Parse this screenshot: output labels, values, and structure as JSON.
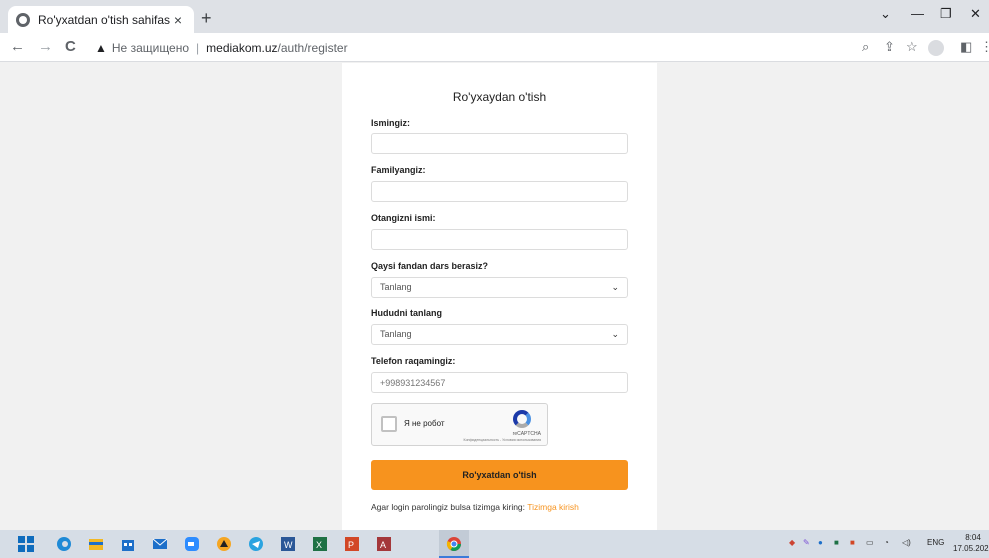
{
  "browser": {
    "tab_title": "Ro'yxatdan o'tish sahifasi",
    "tab_close": "×",
    "new_tab": "+",
    "minimize": "—",
    "restore": "❐",
    "close": "✕",
    "back": "←",
    "forward": "→",
    "reload": "C",
    "insecure_label": "Не защищено",
    "url_host": "mediakom.uz",
    "url_path": "/auth/register",
    "zoom_icon": "⌕",
    "share_icon": "⇪",
    "bookmark_icon": "☆",
    "sidepanel_icon": "◧",
    "menu_icon": "⋮"
  },
  "form": {
    "title": "Ro'yxaydan o'tish",
    "fields": {
      "first_name": {
        "label": "Ismingiz:",
        "value": ""
      },
      "last_name": {
        "label": "Familyangiz:",
        "value": ""
      },
      "patronymic": {
        "label": "Otangizni ismi:",
        "value": ""
      },
      "subject": {
        "label": "Qaysi fandan dars berasiz?",
        "selected": "Tanlang"
      },
      "region": {
        "label": "Hududni tanlang",
        "selected": "Tanlang"
      },
      "phone": {
        "label": "Telefon raqamingiz:",
        "placeholder": "+998931234567"
      }
    },
    "captcha": {
      "label": "Я не робот",
      "brand": "reCAPTCHA",
      "terms": "Конфиденциальность - Условия использования"
    },
    "submit_label": "Ro'yxatdan o'tish",
    "footer_text": "Agar login parolingiz bulsa tizimga kiring: ",
    "footer_link": "Tizimga kirish"
  },
  "taskbar": {
    "language": "ENG",
    "time": "8:04",
    "date": "17.05.2022",
    "accent_color": "#3c7bd9"
  },
  "colors": {
    "accent": "#f7931e"
  }
}
